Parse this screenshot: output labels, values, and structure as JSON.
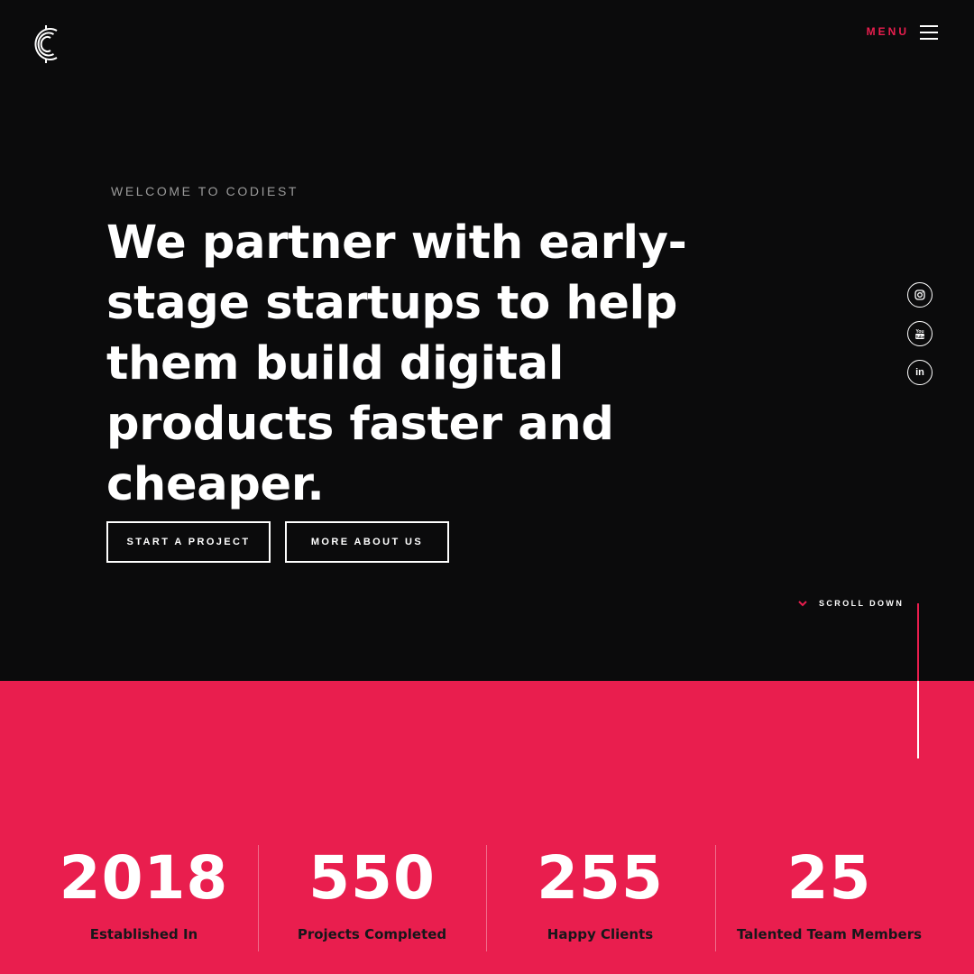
{
  "brand": {
    "logo_icon": "codiest-c-logo-icon",
    "accent_color": "#e91e4e"
  },
  "nav": {
    "menu_label": "MENU",
    "menu_icon": "hamburger-icon"
  },
  "hero": {
    "eyebrow": "WELCOME TO CODIEST",
    "headline": "We partner with early-stage startups to help them build digital products faster and cheaper.",
    "buttons": {
      "start_project": "START A PROJECT",
      "more_about": "MORE ABOUT US"
    },
    "scroll_label": "SCROLL DOWN"
  },
  "social": [
    {
      "name": "instagram-icon"
    },
    {
      "name": "youtube-icon"
    },
    {
      "name": "linkedin-icon",
      "glyph": "in"
    }
  ],
  "stats": [
    {
      "value": "2018",
      "label": "Established In"
    },
    {
      "value": "550",
      "label": "Projects Completed"
    },
    {
      "value": "255",
      "label": "Happy Clients"
    },
    {
      "value": "25",
      "label": "Talented Team Members"
    }
  ]
}
